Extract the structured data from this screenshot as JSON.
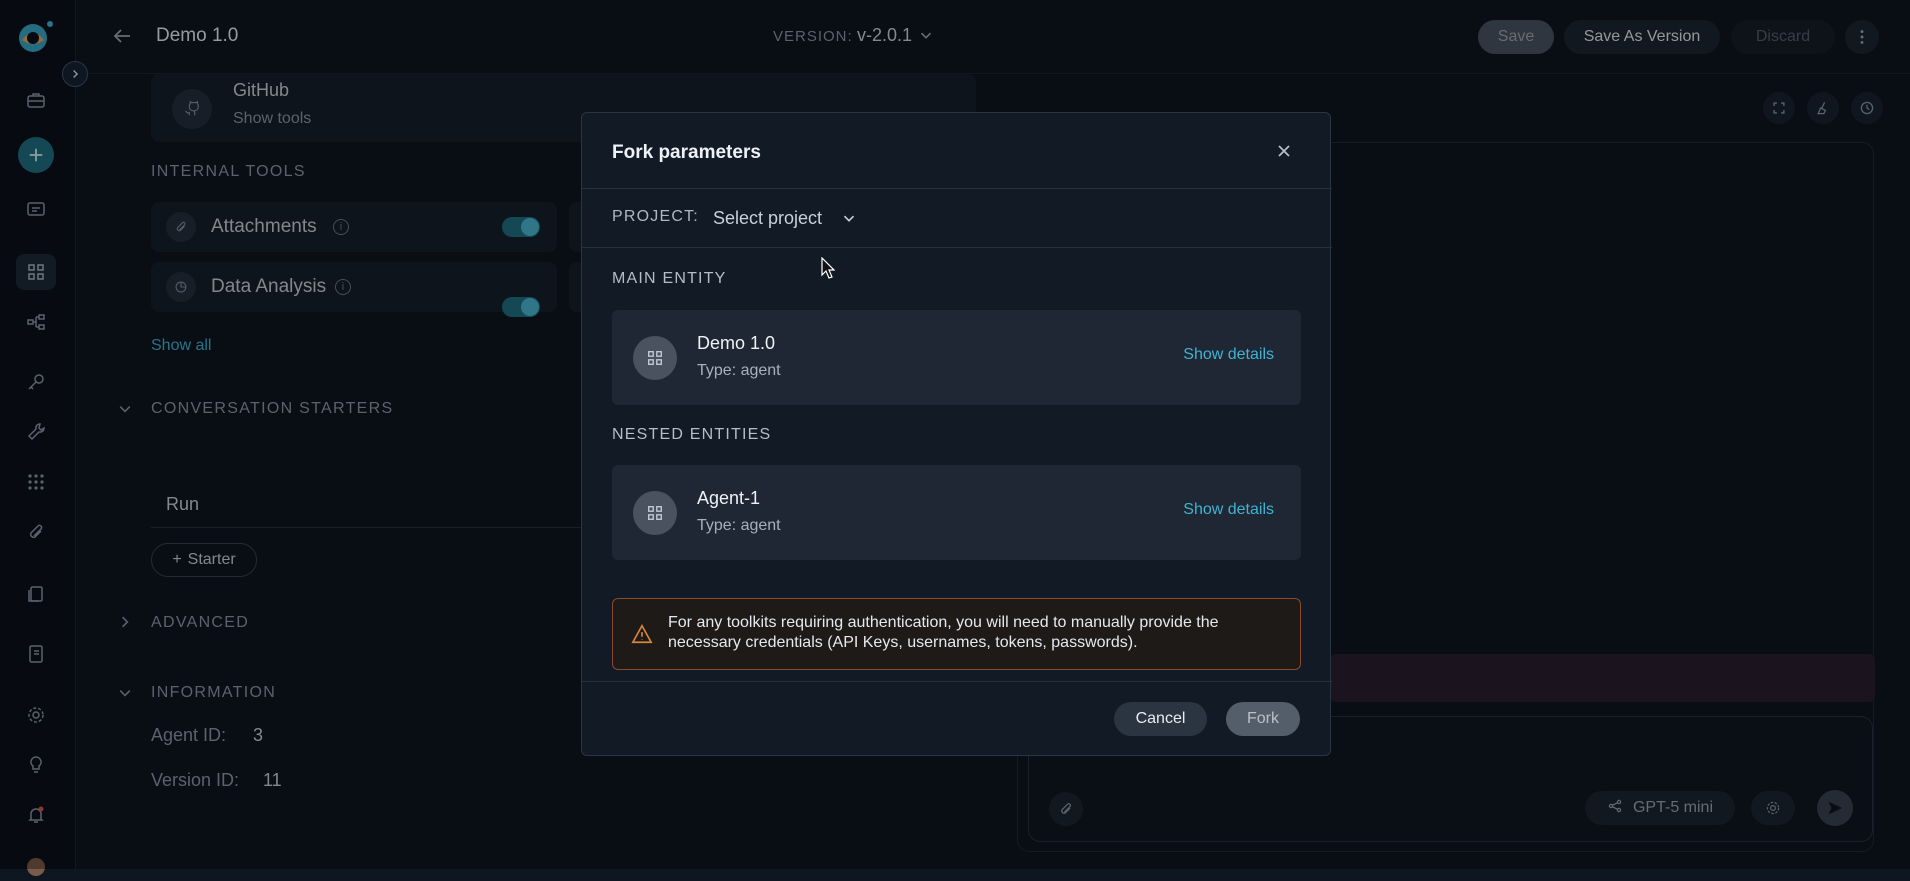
{
  "header": {
    "title": "Demo 1.0",
    "version_label": "VERSION:",
    "version_value": "v-2.0.1",
    "save_label": "Save",
    "save_as_label": "Save As Version",
    "discard_label": "Discard"
  },
  "background": {
    "github_title": "GitHub",
    "github_sub": "Show tools",
    "internal_tools_heading": "INTERNAL TOOLS",
    "tools": [
      {
        "label": "Attachments"
      },
      {
        "label": "Data Analysis"
      }
    ],
    "show_all": "Show all",
    "conversation_starters": "CONVERSATION STARTERS",
    "starter_run": "Run",
    "starter_button": "Starter",
    "advanced": "ADVANCED",
    "information": "INFORMATION",
    "agent_id_label": "Agent ID:",
    "agent_id_value": "3",
    "version_id_label": "Version ID:",
    "version_id_value": "11",
    "model_label": "GPT-5 mini"
  },
  "modal": {
    "title": "Fork parameters",
    "project_label": "PROJECT:",
    "project_placeholder": "Select project",
    "main_entity_heading": "MAIN ENTITY",
    "main_entity": {
      "name": "Demo 1.0",
      "type": "Type: agent",
      "link": "Show details"
    },
    "nested_heading": "NESTED ENTITIES",
    "nested_entity": {
      "name": "Agent-1",
      "type": "Type: agent",
      "link": "Show details"
    },
    "warning": "For any toolkits requiring authentication, you will need to manually provide the necessary credentials (API Keys, usernames, tokens, passwords).",
    "cancel_label": "Cancel",
    "fork_label": "Fork"
  },
  "colors": {
    "accent": "#3fb3d2",
    "warning_border": "#8a4a2a",
    "warning_icon": "#d9853b"
  }
}
